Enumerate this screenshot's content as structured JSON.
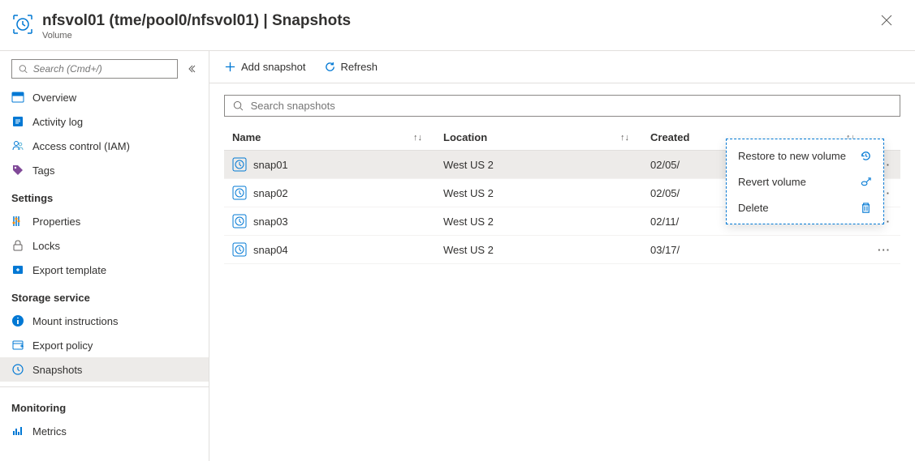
{
  "header": {
    "title": "nfsvol01 (tme/pool0/nfsvol01) | Snapshots",
    "subtitle": "Volume"
  },
  "sidebar": {
    "search_placeholder": "Search (Cmd+/)",
    "items": {
      "overview": "Overview",
      "activity": "Activity log",
      "access": "Access control (IAM)",
      "tags": "Tags"
    },
    "sections": {
      "settings": "Settings",
      "storage": "Storage service",
      "monitoring": "Monitoring"
    },
    "settings_items": {
      "properties": "Properties",
      "locks": "Locks",
      "export_template": "Export template"
    },
    "storage_items": {
      "mount": "Mount instructions",
      "export_policy": "Export policy",
      "snapshots": "Snapshots"
    },
    "monitoring_items": {
      "metrics": "Metrics"
    }
  },
  "toolbar": {
    "add_snapshot": "Add snapshot",
    "refresh": "Refresh"
  },
  "search_snapshots_placeholder": "Search snapshots",
  "columns": {
    "name": "Name",
    "location": "Location",
    "created": "Created"
  },
  "rows": [
    {
      "name": "snap01",
      "location": "West US 2",
      "created": "02/05/"
    },
    {
      "name": "snap02",
      "location": "West US 2",
      "created": "02/05/"
    },
    {
      "name": "snap03",
      "location": "West US 2",
      "created": "02/11/"
    },
    {
      "name": "snap04",
      "location": "West US 2",
      "created": "03/17/"
    }
  ],
  "context_menu": {
    "restore": "Restore to new volume",
    "revert": "Revert volume",
    "delete": "Delete"
  }
}
